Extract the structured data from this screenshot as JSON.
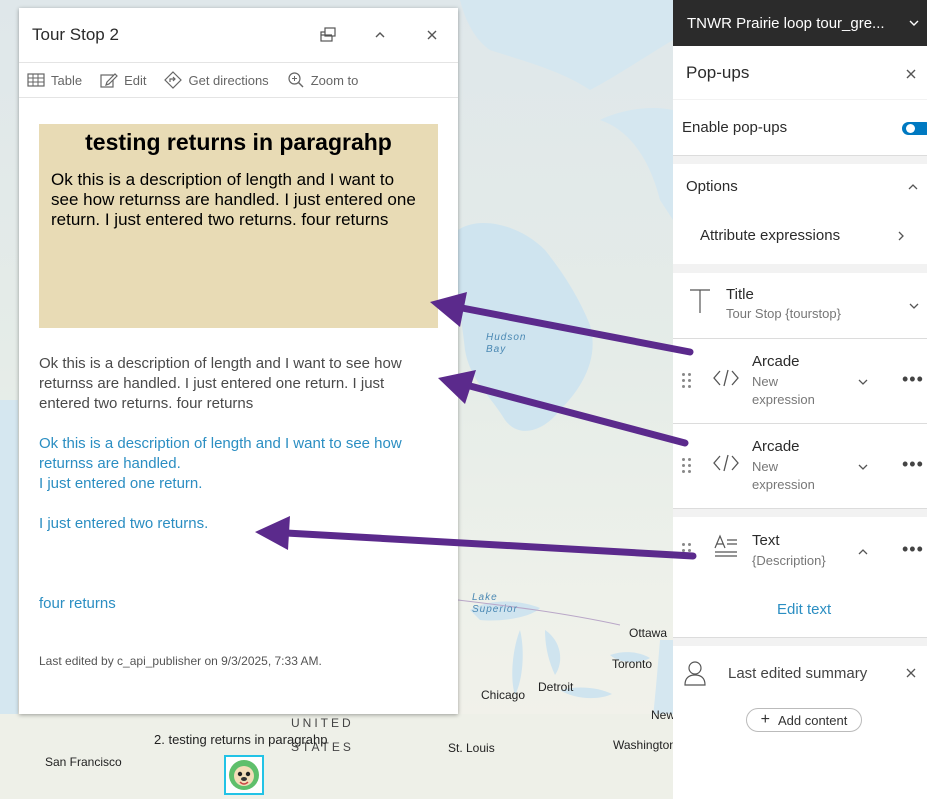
{
  "map": {
    "labels": {
      "hudson_bay": "Hudson\nBay",
      "lake_superior": "Lake\nSuperior",
      "ottawa": "Ottawa",
      "toronto": "Toronto",
      "detroit": "Detroit",
      "chicago": "Chicago",
      "new": "New",
      "washington": "Washington",
      "st_louis": "St. Louis",
      "san_francisco": "San Francisco",
      "united": "UNITED",
      "states": "STATES",
      "feature_label": "2. testing returns in paragrahp"
    }
  },
  "popup": {
    "title": "Tour Stop 2",
    "toolbar": {
      "table": "Table",
      "edit": "Edit",
      "directions": "Get directions",
      "zoom": "Zoom to"
    },
    "arcade_box": {
      "title": "testing returns in paragrahp",
      "description": "Ok this is a description of length and I want to see how returnss are handled. I just entered one return. I just entered two returns. four returns",
      "background": "#e8dbb5"
    },
    "plain_description": "Ok this is a description of length and I want to see how returnss are handled. I just entered one return. I just entered two returns. four returns",
    "text_element": {
      "line1": "Ok this is a description of length and I want to see how returnss are handled.",
      "line2": "I just entered one return.",
      "line3": "I just entered two returns.",
      "line4": "four returns",
      "color": "#2b8ec2"
    },
    "last_edited": "Last edited by c_api_publisher on 9/3/2025, 7:33 AM."
  },
  "panel": {
    "layer_title": "TNWR Prairie loop tour_gre...",
    "heading": "Pop-ups",
    "enable_label": "Enable pop-ups",
    "options_label": "Options",
    "attribute_expressions": "Attribute expressions",
    "title_element": {
      "label": "Title",
      "sub": "Tour Stop {tourstop}"
    },
    "arcade1": {
      "label": "Arcade",
      "sub1": "New",
      "sub2": "expression"
    },
    "arcade2": {
      "label": "Arcade",
      "sub1": "New",
      "sub2": "expression"
    },
    "text_el": {
      "label": "Text",
      "sub": "{Description}"
    },
    "edit_text": "Edit text",
    "last_edited_summary": "Last edited summary",
    "add_content": "Add content",
    "accent": "#0079c1"
  },
  "annotation_color": "#5b2a8c"
}
